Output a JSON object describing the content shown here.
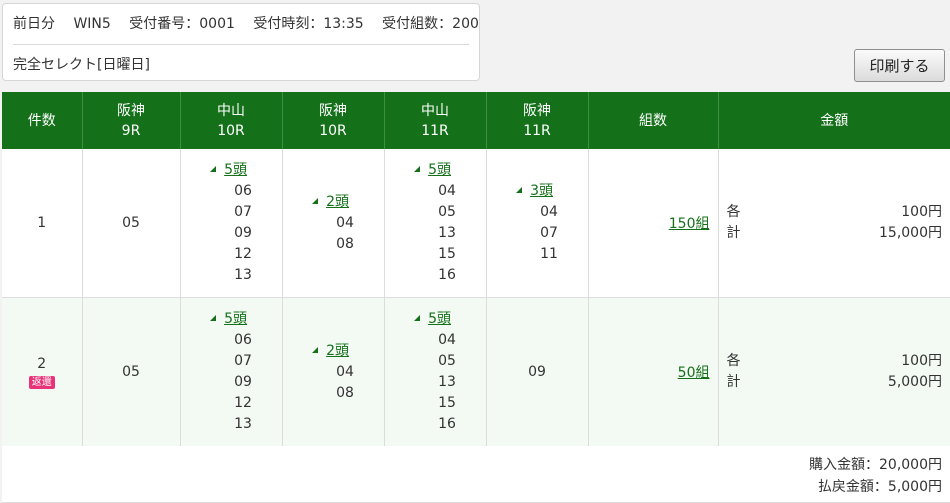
{
  "info": {
    "day": "前日分",
    "bet_type": "WIN5",
    "receipt_no": "受付番号：0001",
    "receipt_time": "受付時刻：13:35",
    "combo_count": "受付組数：200",
    "mode": "完全セレクト[日曜日]"
  },
  "print_label": "印刷する",
  "headers": {
    "count": "件数",
    "r1_venue": "阪神",
    "r1_race": "9R",
    "r2_venue": "中山",
    "r2_race": "10R",
    "r3_venue": "阪神",
    "r3_race": "10R",
    "r4_venue": "中山",
    "r4_race": "11R",
    "r5_venue": "阪神",
    "r5_race": "11R",
    "kumi": "組数",
    "amount": "金額"
  },
  "rows": [
    {
      "no": "1",
      "badge": "",
      "r1": "05",
      "r2_count": "5頭",
      "r2": [
        "06",
        "07",
        "09",
        "12",
        "13"
      ],
      "r3_count": "2頭",
      "r3": [
        "04",
        "08"
      ],
      "r4_count": "5頭",
      "r4": [
        "04",
        "05",
        "13",
        "15",
        "16"
      ],
      "r5_count": "3頭",
      "r5": [
        "04",
        "07",
        "11"
      ],
      "kumi": "150組",
      "each_label": "各",
      "total_label": "計",
      "each": "100円",
      "total": "15,000円"
    },
    {
      "no": "2",
      "badge": "返還",
      "r1": "05",
      "r2_count": "5頭",
      "r2": [
        "06",
        "07",
        "09",
        "12",
        "13"
      ],
      "r3_count": "2頭",
      "r3": [
        "04",
        "08"
      ],
      "r4_count": "5頭",
      "r4": [
        "04",
        "05",
        "13",
        "15",
        "16"
      ],
      "r5": "09",
      "kumi": "50組",
      "each_label": "各",
      "total_label": "計",
      "each": "100円",
      "total": "5,000円"
    }
  ],
  "footer": {
    "purchase": "購入金額：20,000円",
    "refund": "払戻金額：5,000円"
  }
}
